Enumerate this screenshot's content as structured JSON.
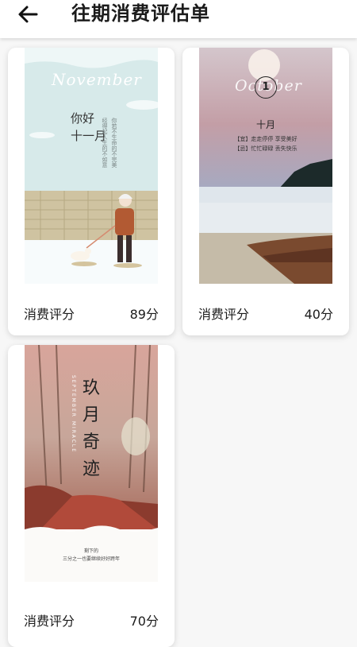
{
  "header": {
    "title": "往期消费评估单",
    "back_icon": "arrow-left-icon"
  },
  "cards": [
    {
      "poster": {
        "month_en": "November",
        "month_cn": [
          "你好",
          "十一月"
        ],
        "verse": [
          "你若不生命的不完美",
          "经得起人生的不如意"
        ],
        "bg": "#d8eaea"
      },
      "rating_label": "消费评分",
      "rating_score": "89分"
    },
    {
      "poster": {
        "month_en": "October",
        "day": "1",
        "month_cn": "十月",
        "line1": "【宜】走走停停  享受美好",
        "line2": "【忌】忙忙碌碌  丢失快乐"
      },
      "rating_label": "消费评分",
      "rating_score": "40分"
    },
    {
      "poster": {
        "title_chars": [
          "玖",
          "月",
          "奇",
          "迹"
        ],
        "subtitle_en": "SEPTEMBER MIRACLE",
        "foot1": "剩下的",
        "foot2": "三分之一也要继续好好跨年"
      },
      "rating_label": "消费评分",
      "rating_score": "70分"
    }
  ]
}
